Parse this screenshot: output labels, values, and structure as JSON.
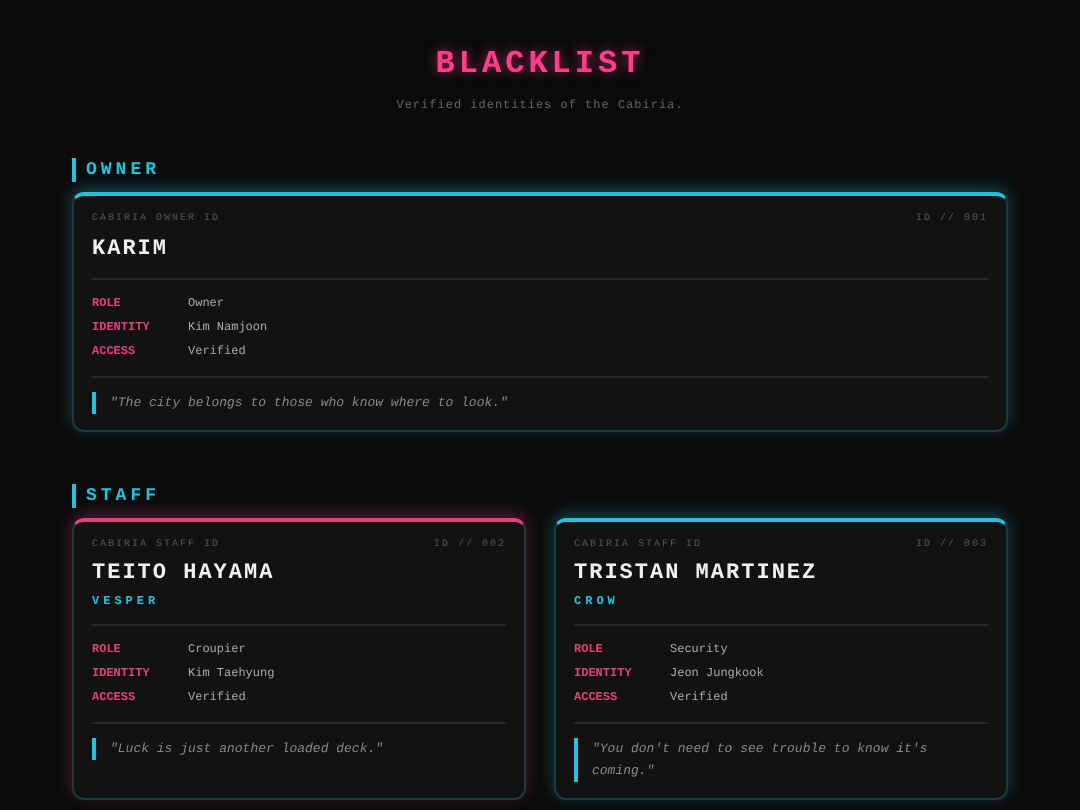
{
  "header": {
    "title": "BLACKLIST",
    "subtitle": "Verified identities of the Cabiria."
  },
  "sections": [
    {
      "heading": "OWNER",
      "cards": [
        {
          "tag": "CABIRIA OWNER ID",
          "id": "ID // 001",
          "name": "KARIM",
          "color": "#22c4dc",
          "fields": [
            {
              "label": "ROLE",
              "value": "Owner"
            },
            {
              "label": "IDENTITY",
              "value": "Kim Namjoon"
            },
            {
              "label": "ACCESS",
              "value": "Verified"
            }
          ],
          "quote": "\"The city belongs to those who know where to look.\""
        }
      ]
    },
    {
      "heading": "STAFF",
      "cards": [
        {
          "tag": "CABIRIA STAFF ID",
          "id": "ID // 002",
          "name": "TEITO HAYAMA",
          "alias": "VESPER",
          "color": "#e0407e",
          "fields": [
            {
              "label": "ROLE",
              "value": "Croupier"
            },
            {
              "label": "IDENTITY",
              "value": "Kim Taehyung"
            },
            {
              "label": "ACCESS",
              "value": "Verified"
            }
          ],
          "quote": "\"Luck is just another loaded deck.\""
        },
        {
          "tag": "CABIRIA STAFF ID",
          "id": "ID // 003",
          "name": "TRISTAN MARTINEZ",
          "alias": "CROW",
          "color": "#22c4dc",
          "fields": [
            {
              "label": "ROLE",
              "value": "Security"
            },
            {
              "label": "IDENTITY",
              "value": "Jeon Jungkook"
            },
            {
              "label": "ACCESS",
              "value": "Verified"
            }
          ],
          "quote": "\"You don't need to see trouble to know it's coming.\""
        }
      ]
    }
  ]
}
